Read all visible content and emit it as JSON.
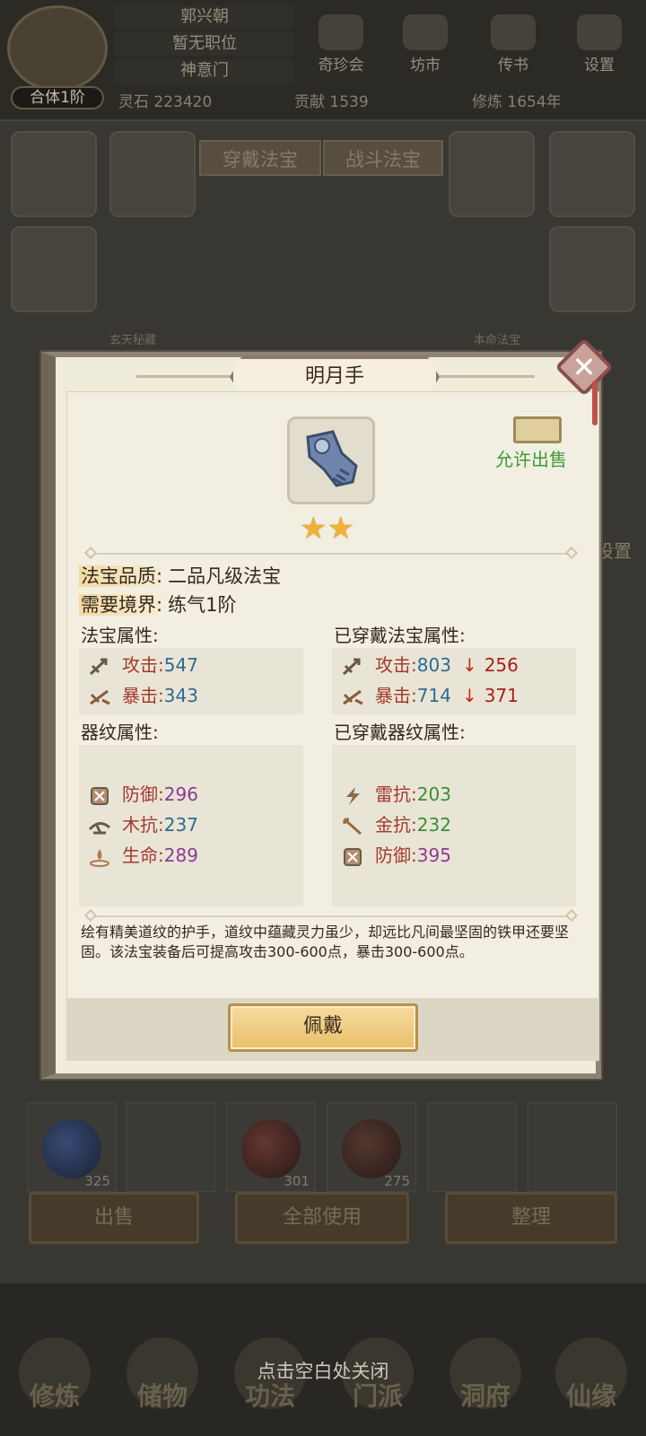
{
  "player": {
    "name": "郭兴朝",
    "position": "暂无职位",
    "sect": "神意门",
    "realm": "合体1阶"
  },
  "top_menu": [
    {
      "label": "奇珍会",
      "icon": "treasure-icon"
    },
    {
      "label": "坊市",
      "icon": "market-icon"
    },
    {
      "label": "传书",
      "icon": "letter-icon"
    },
    {
      "label": "设置",
      "icon": "gear-icon"
    }
  ],
  "resources": {
    "spirit_stone": "灵石 223420",
    "contribution": "贡献 1539",
    "cultivation": "修炼 1654年"
  },
  "equip_tabs": [
    "穿戴法宝",
    "战斗法宝"
  ],
  "background_labels": {
    "left": "玄天秘藏",
    "right": "本命法宝",
    "settings_partial": "设置"
  },
  "bag": {
    "counts": [
      "325",
      "301",
      "275"
    ],
    "buttons": [
      "出售",
      "全部使用",
      "整理"
    ]
  },
  "nav": [
    "修炼",
    "储物",
    "功法",
    "门派",
    "洞府",
    "仙缘"
  ],
  "close_hint": "点击空白处关闭",
  "dialog": {
    "title": "明月手",
    "item_icon": "gauntlet-icon",
    "sale_status": "允许出售",
    "stars": 2,
    "quality_label": "法宝品质:",
    "quality_value": "二品凡级法宝",
    "realm_label": "需要境界:",
    "realm_value": "练气1阶",
    "attr_title": "法宝属性:",
    "equipped_attr_title": "已穿戴法宝属性:",
    "pattern_title": "器纹属性:",
    "equipped_pattern_title": "已穿戴器纹属性:",
    "attrs": [
      {
        "label": "攻击:",
        "value": "547",
        "icon": "attack-icon"
      },
      {
        "label": "暴击:",
        "value": "343",
        "icon": "crit-icon"
      }
    ],
    "equipped_attrs": [
      {
        "label": "攻击:",
        "value": "803",
        "arrow": "↓",
        "diff": "256",
        "icon": "attack-icon"
      },
      {
        "label": "暴击:",
        "value": "714",
        "arrow": "↓",
        "diff": "371",
        "icon": "crit-icon"
      }
    ],
    "patterns": [
      {
        "label": "防御:",
        "value": "296",
        "icon": "defense-icon"
      },
      {
        "label": "木抗:",
        "value": "237",
        "icon": "wood-resist-icon"
      },
      {
        "label": "生命:",
        "value": "289",
        "icon": "life-icon"
      }
    ],
    "equipped_patterns": [
      {
        "label": "雷抗:",
        "value": "203",
        "icon": "thunder-resist-icon"
      },
      {
        "label": "金抗:",
        "value": "232",
        "icon": "metal-resist-icon"
      },
      {
        "label": "防御:",
        "value": "395",
        "icon": "defense-icon"
      }
    ],
    "description": "绘有精美道纹的护手，道纹中蕴藏灵力虽少，却远比凡间最坚固的铁甲还要坚固。该法宝装备后可提高攻击300-600点，暴击300-600点。",
    "wear_button": "佩戴"
  }
}
